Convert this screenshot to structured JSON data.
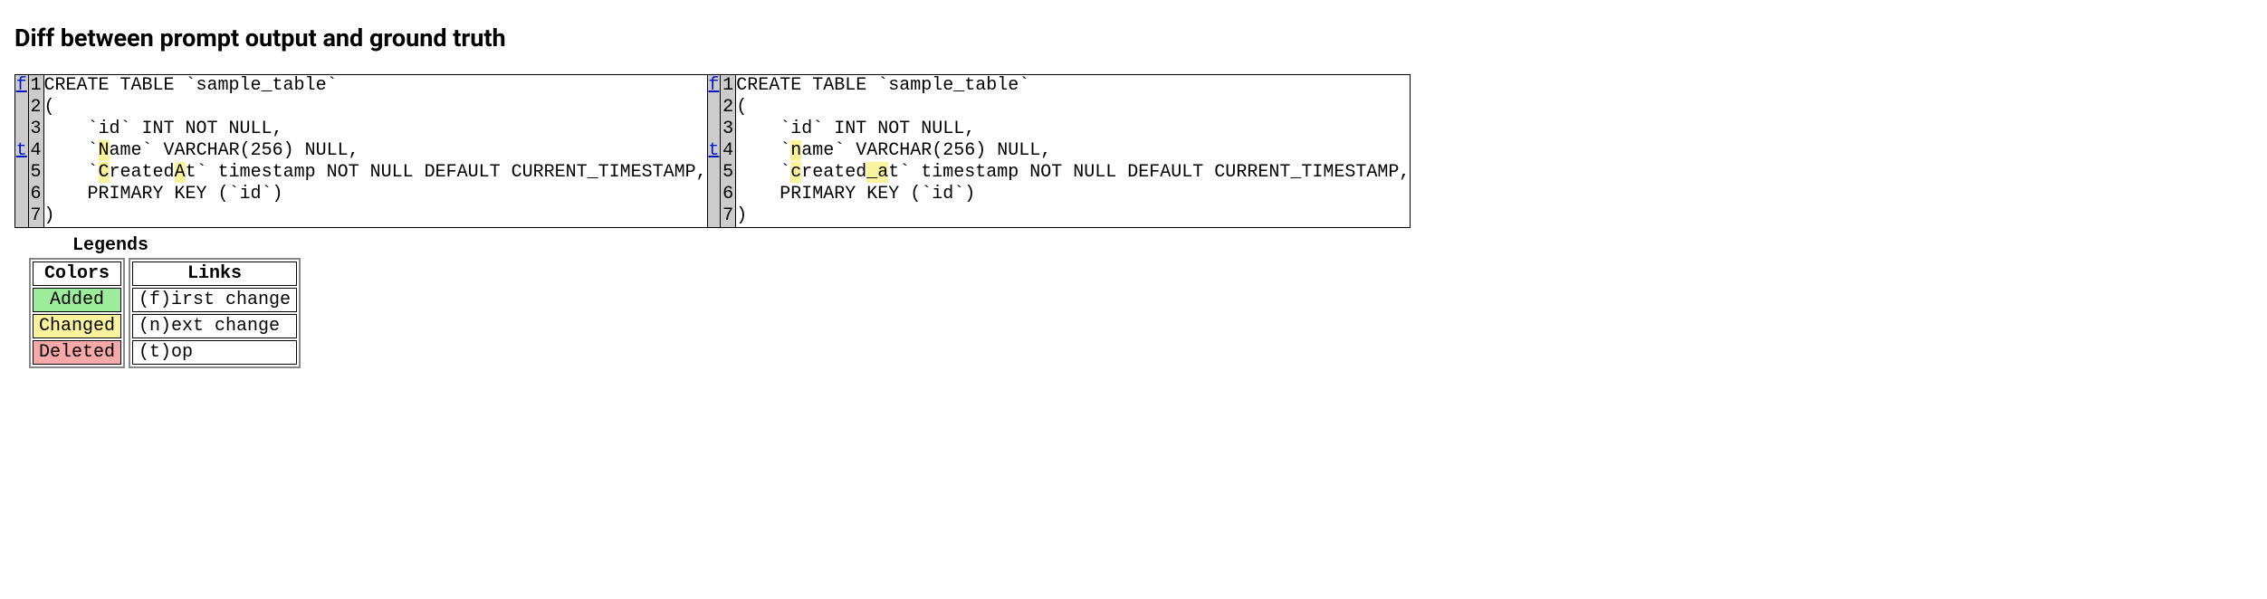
{
  "title": "Diff between prompt output and ground truth",
  "diff": {
    "left": {
      "gutter_links": [
        "f",
        "",
        "",
        "t",
        "",
        "",
        ""
      ],
      "line_numbers": [
        "1",
        "2",
        "3",
        "4",
        "5",
        "6",
        "7"
      ],
      "lines": [
        {
          "segments": [
            {
              "t": "CREATE TABLE `sample_table`"
            }
          ]
        },
        {
          "segments": [
            {
              "t": "("
            }
          ]
        },
        {
          "segments": [
            {
              "t": "    `id` INT NOT NULL,"
            }
          ]
        },
        {
          "segments": [
            {
              "t": "    `"
            },
            {
              "t": "N",
              "c": "chg"
            },
            {
              "t": "ame` VARCHAR(256) NULL,"
            }
          ]
        },
        {
          "segments": [
            {
              "t": "    `"
            },
            {
              "t": "C",
              "c": "chg"
            },
            {
              "t": "reated"
            },
            {
              "t": "A",
              "c": "chg"
            },
            {
              "t": "t` timestamp NOT NULL DEFAULT CURRENT_TIMESTAMP,"
            }
          ]
        },
        {
          "segments": [
            {
              "t": "    PRIMARY KEY (`id`)"
            }
          ]
        },
        {
          "segments": [
            {
              "t": ")"
            }
          ]
        }
      ]
    },
    "right": {
      "gutter_links": [
        "f",
        "",
        "",
        "t",
        "",
        "",
        ""
      ],
      "line_numbers": [
        "1",
        "2",
        "3",
        "4",
        "5",
        "6",
        "7"
      ],
      "lines": [
        {
          "segments": [
            {
              "t": "CREATE TABLE `sample_table`"
            }
          ]
        },
        {
          "segments": [
            {
              "t": "("
            }
          ]
        },
        {
          "segments": [
            {
              "t": "    `id` INT NOT NULL,"
            }
          ]
        },
        {
          "segments": [
            {
              "t": "    `"
            },
            {
              "t": "n",
              "c": "chg"
            },
            {
              "t": "ame` VARCHAR(256) NULL,"
            }
          ]
        },
        {
          "segments": [
            {
              "t": "    `"
            },
            {
              "t": "c",
              "c": "chg"
            },
            {
              "t": "reated"
            },
            {
              "t": "_a",
              "c": "chg"
            },
            {
              "t": "t` timestamp NOT NULL DEFAULT CURRENT_TIMESTAMP,"
            }
          ]
        },
        {
          "segments": [
            {
              "t": "    PRIMARY KEY (`id`)"
            }
          ]
        },
        {
          "segments": [
            {
              "t": ")"
            }
          ]
        }
      ]
    }
  },
  "legends": {
    "title": "Legends",
    "colors": {
      "header": "Colors",
      "rows": [
        {
          "label": "Added",
          "cls": "bg-added"
        },
        {
          "label": "Changed",
          "cls": "bg-changed"
        },
        {
          "label": "Deleted",
          "cls": "bg-deleted"
        }
      ]
    },
    "links": {
      "header": "Links",
      "rows": [
        {
          "label": "(f)irst change"
        },
        {
          "label": "(n)ext change"
        },
        {
          "label": "(t)op"
        }
      ]
    }
  }
}
